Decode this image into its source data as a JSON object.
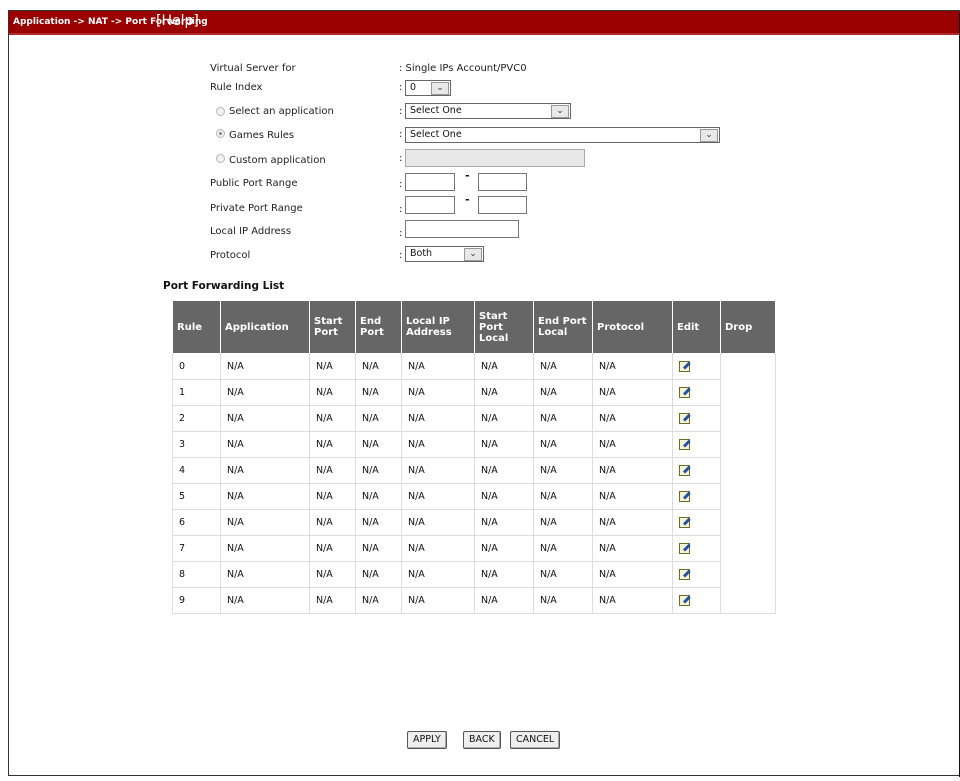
{
  "header": {
    "breadcrumb": "Application -> NAT -> Port Forwarding",
    "help": "[Help]"
  },
  "form": {
    "virtual_server_label": "Virtual Server for",
    "virtual_server_value": ": Single IPs Account/PVC0",
    "rule_index_label": "Rule Index",
    "rule_index_value": "0",
    "select_app_label": "Select an application",
    "select_app_value": "Select One",
    "games_rules_label": "Games Rules",
    "games_rules_value": "Select One",
    "custom_app_label": "Custom application",
    "public_port_label": "Public Port Range",
    "private_port_label": "Private Port Range",
    "local_ip_label": "Local IP Address",
    "protocol_label": "Protocol",
    "protocol_value": "Both",
    "colon": ":",
    "dash": "-"
  },
  "list": {
    "title": "Port Forwarding List",
    "headers": [
      "Rule",
      "Application",
      "Start Port",
      "End Port",
      "Local IP Address",
      "Start Port Local",
      "End Port Local",
      "Protocol",
      "Edit",
      "Drop"
    ],
    "rows": [
      {
        "rule": "0",
        "application": "N/A",
        "start_port": "N/A",
        "end_port": "N/A",
        "local_ip": "N/A",
        "start_port_local": "N/A",
        "end_port_local": "N/A",
        "protocol": "N/A"
      },
      {
        "rule": "1",
        "application": "N/A",
        "start_port": "N/A",
        "end_port": "N/A",
        "local_ip": "N/A",
        "start_port_local": "N/A",
        "end_port_local": "N/A",
        "protocol": "N/A"
      },
      {
        "rule": "2",
        "application": "N/A",
        "start_port": "N/A",
        "end_port": "N/A",
        "local_ip": "N/A",
        "start_port_local": "N/A",
        "end_port_local": "N/A",
        "protocol": "N/A"
      },
      {
        "rule": "3",
        "application": "N/A",
        "start_port": "N/A",
        "end_port": "N/A",
        "local_ip": "N/A",
        "start_port_local": "N/A",
        "end_port_local": "N/A",
        "protocol": "N/A"
      },
      {
        "rule": "4",
        "application": "N/A",
        "start_port": "N/A",
        "end_port": "N/A",
        "local_ip": "N/A",
        "start_port_local": "N/A",
        "end_port_local": "N/A",
        "protocol": "N/A"
      },
      {
        "rule": "5",
        "application": "N/A",
        "start_port": "N/A",
        "end_port": "N/A",
        "local_ip": "N/A",
        "start_port_local": "N/A",
        "end_port_local": "N/A",
        "protocol": "N/A"
      },
      {
        "rule": "6",
        "application": "N/A",
        "start_port": "N/A",
        "end_port": "N/A",
        "local_ip": "N/A",
        "start_port_local": "N/A",
        "end_port_local": "N/A",
        "protocol": "N/A"
      },
      {
        "rule": "7",
        "application": "N/A",
        "start_port": "N/A",
        "end_port": "N/A",
        "local_ip": "N/A",
        "start_port_local": "N/A",
        "end_port_local": "N/A",
        "protocol": "N/A"
      },
      {
        "rule": "8",
        "application": "N/A",
        "start_port": "N/A",
        "end_port": "N/A",
        "local_ip": "N/A",
        "start_port_local": "N/A",
        "end_port_local": "N/A",
        "protocol": "N/A"
      },
      {
        "rule": "9",
        "application": "N/A",
        "start_port": "N/A",
        "end_port": "N/A",
        "local_ip": "N/A",
        "start_port_local": "N/A",
        "end_port_local": "N/A",
        "protocol": "N/A"
      }
    ]
  },
  "buttons": {
    "apply": "APPLY",
    "back": "BACK",
    "cancel": "CANCEL"
  },
  "colors": {
    "header_bg": "#9b0000",
    "table_header_bg": "#666666"
  }
}
